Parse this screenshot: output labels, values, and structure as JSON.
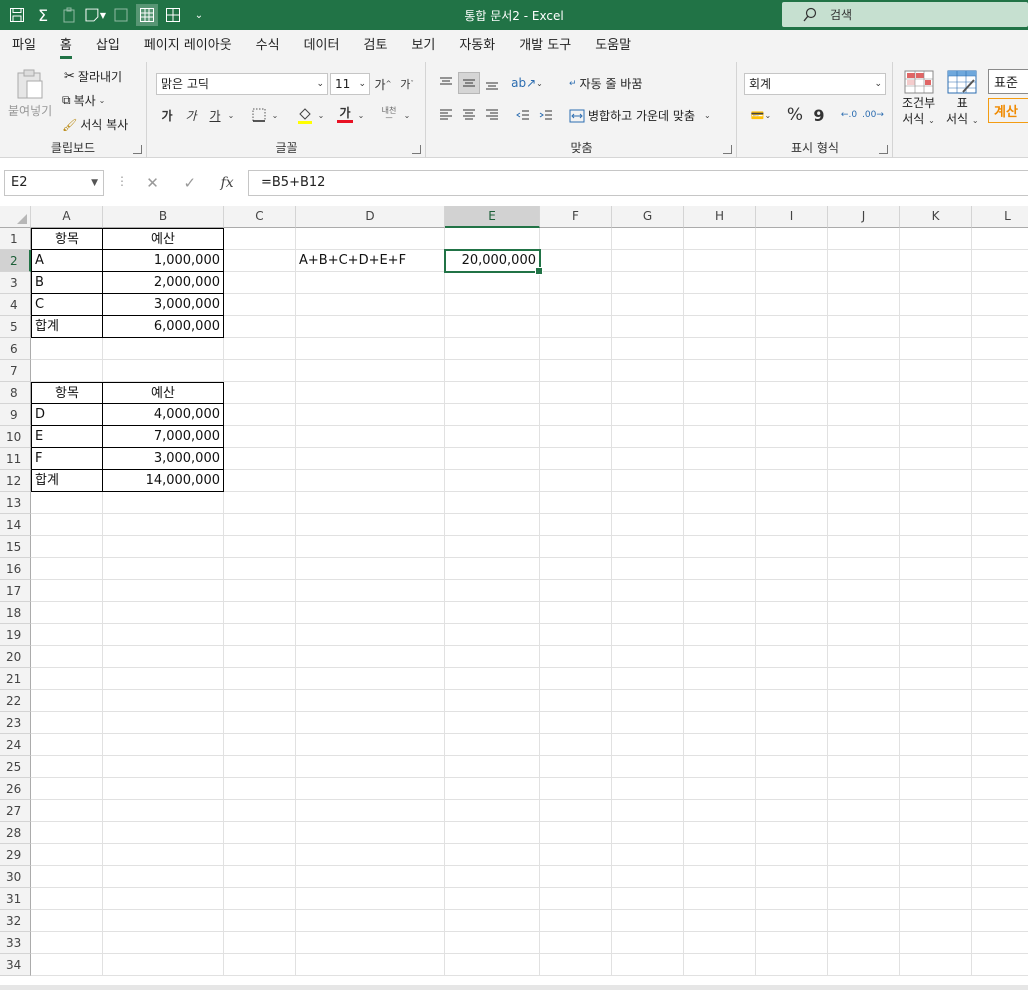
{
  "titlebar": {
    "title": "통합 문서2  -  Excel",
    "search_placeholder": "검색",
    "qat_icons": [
      "save-icon",
      "autosum-icon",
      "paste-icon",
      "form-icon",
      "borders-icon",
      "gridlines-icon",
      "table-icon",
      "customize-icon"
    ]
  },
  "menu": {
    "tabs": [
      "파일",
      "홈",
      "삽입",
      "페이지 레이아웃",
      "수식",
      "데이터",
      "검토",
      "보기",
      "자동화",
      "개발 도구",
      "도움말"
    ],
    "active": "홈"
  },
  "ribbon": {
    "clipboard": {
      "label": "클립보드",
      "paste": "붙여넣기",
      "cut": "잘라내기",
      "copy": "복사",
      "format_painter": "서식 복사"
    },
    "font": {
      "label": "글꼴",
      "font_name": "맑은 고딕",
      "font_size": "11",
      "grow": "가",
      "shrink": "가",
      "bold": "가",
      "italic": "가",
      "underline": "가",
      "color_label": "가",
      "phonetic": "내천",
      "font_color": "#e81123"
    },
    "alignment": {
      "label": "맞춤",
      "wrap_text": "자동 줄 바꿈",
      "merge_center": "병합하고 가운데 맞춤"
    },
    "number": {
      "label": "표시 형식",
      "format": "회계",
      "percent": "%",
      "comma": "9"
    },
    "styles": {
      "conditional": [
        "조건부",
        "서식"
      ],
      "table": [
        "표",
        "서식"
      ],
      "normal": "표준",
      "calc": "계산"
    }
  },
  "formula_bar": {
    "name_box": "E2",
    "formula": "=B5+B12"
  },
  "sheet": {
    "columns": [
      "A",
      "B",
      "C",
      "D",
      "E",
      "F",
      "G",
      "H",
      "I",
      "J",
      "K",
      "L"
    ],
    "selected_column": "E",
    "selected_row": 2,
    "row_count": 34,
    "cells": {
      "A1": "항목",
      "B1": "예산",
      "A2": "A",
      "B2": "1,000,000",
      "D2": "A+B+C+D+E+F",
      "E2": "20,000,000",
      "A3": "B",
      "B3": "2,000,000",
      "A4": "C",
      "B4": "3,000,000",
      "A5": "합계",
      "B5": "6,000,000",
      "A8": "항목",
      "B8": "예산",
      "A9": "D",
      "B9": "4,000,000",
      "A10": "E",
      "B10": "7,000,000",
      "A11": "F",
      "B11": "3,000,000",
      "A12": "합계",
      "B12": "14,000,000"
    }
  }
}
